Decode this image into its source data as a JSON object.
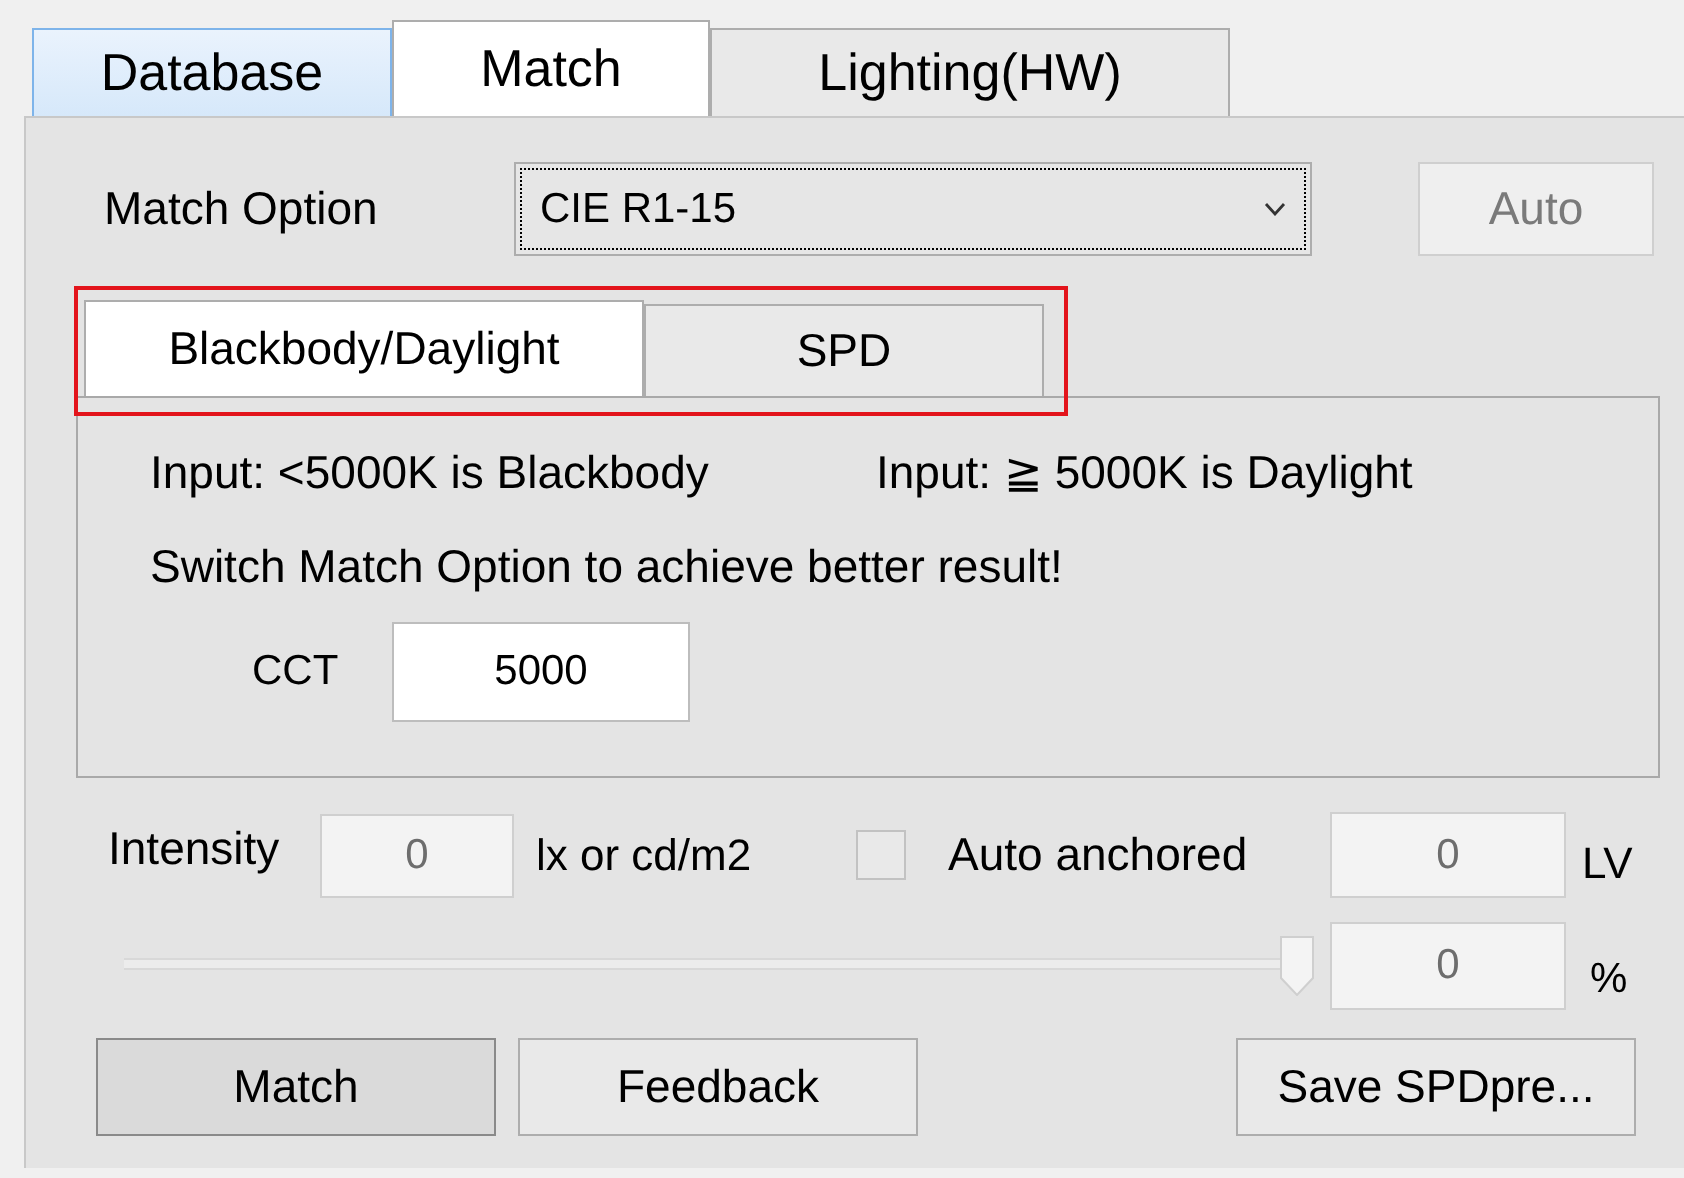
{
  "tabs": [
    {
      "label": "Database",
      "selected": false,
      "hover": true
    },
    {
      "label": "Match",
      "selected": true,
      "hover": false
    },
    {
      "label": "Lighting(HW)",
      "selected": false,
      "hover": false
    }
  ],
  "match_option": {
    "label": "Match Option",
    "value": "CIE R1-15",
    "focused": true
  },
  "auto_button": {
    "label": "Auto",
    "disabled": true
  },
  "sub_tabs": {
    "highlighted": true,
    "items": [
      {
        "label": "Blackbody/Daylight",
        "selected": true
      },
      {
        "label": "SPD",
        "selected": false
      }
    ]
  },
  "info": {
    "left": "Input: <5000K is Blackbody",
    "right": "Input: ≧ 5000K is Daylight",
    "hint": "Switch Match Option to achieve better result!"
  },
  "cct": {
    "label": "CCT",
    "value": "5000"
  },
  "intensity": {
    "label": "Intensity",
    "value": "0",
    "disabled": true,
    "unit": "lx or cd/m2"
  },
  "auto_anchored": {
    "label": "Auto anchored",
    "checked": false,
    "value": "0",
    "disabled": true,
    "unit": "LV"
  },
  "slider": {
    "level": 1.0,
    "value": "0",
    "disabled": true,
    "unit": "%"
  },
  "buttons": [
    {
      "label": "Match",
      "pressed": true
    },
    {
      "label": "Feedback",
      "pressed": false
    },
    {
      "label": "Save SPDpre...",
      "pressed": false
    }
  ]
}
